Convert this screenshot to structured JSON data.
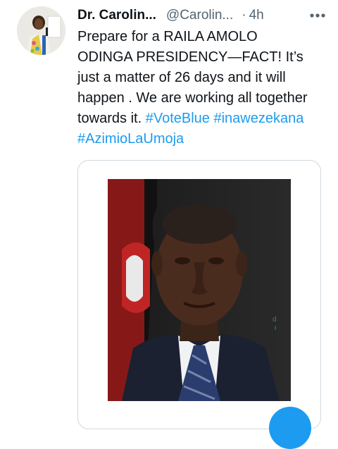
{
  "author": {
    "display_name": "Dr. Carolin...",
    "handle": "@Carolin...",
    "separator": "·",
    "time": "4h"
  },
  "icons": {
    "more": "more-horizontal-icon",
    "compose": "compose-tweet-icon"
  },
  "tweet": {
    "lines": [
      "Prepare for a RAILA AMOLO",
      "ODINGA PRESIDENCY—FACT! It’s",
      "just a matter of 26 days and it will",
      "happen . We are working all together",
      "towards it."
    ],
    "hashtags": [
      "#VoteBlue",
      "#inawezekana",
      "#AzimioLaUmoja"
    ]
  },
  "media": {
    "watermark": "d"
  },
  "colors": {
    "accent": "#1d9bf0",
    "text": "#0f1419",
    "secondary": "#536471",
    "border": "#cfd9de"
  }
}
